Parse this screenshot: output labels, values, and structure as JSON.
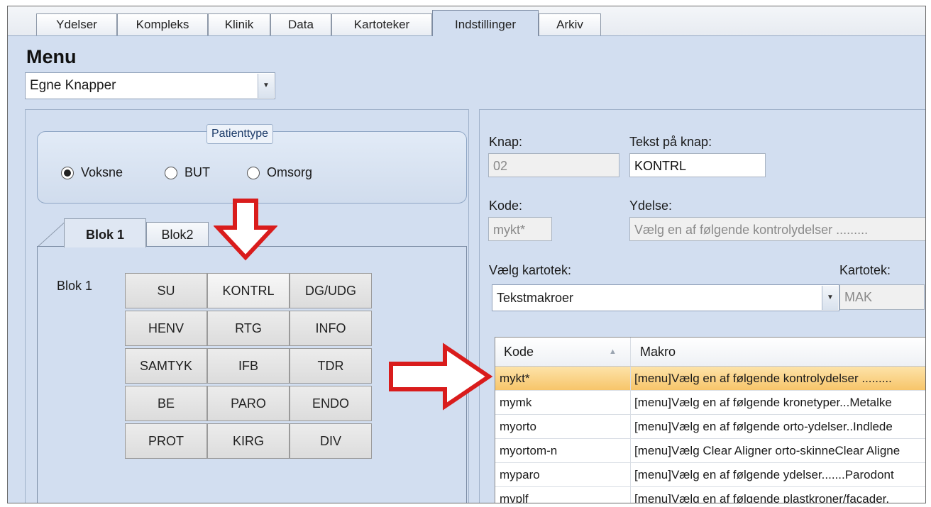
{
  "tabs": [
    "Ydelser",
    "Kompleks",
    "Klinik",
    "Data",
    "Kartoteker",
    "Indstillinger",
    "Arkiv"
  ],
  "active_tab": "Indstillinger",
  "menu": {
    "title": "Menu",
    "selected": "Egne Knapper"
  },
  "patienttype": {
    "title": "Patienttype",
    "options": [
      "Voksne",
      "BUT",
      "Omsorg"
    ],
    "selected": "Voksne"
  },
  "blok_tabs": [
    "Blok 1",
    "Blok2"
  ],
  "blok_label": "Blok 1",
  "grid_buttons": [
    [
      "SU",
      "KONTRL",
      "DG/UDG"
    ],
    [
      "HENV",
      "RTG",
      "INFO"
    ],
    [
      "SAMTYK",
      "IFB",
      "TDR"
    ],
    [
      "BE",
      "PARO",
      "ENDO"
    ],
    [
      "PROT",
      "KIRG",
      "DIV"
    ]
  ],
  "details": {
    "knap_label": "Knap:",
    "knap_value": "02",
    "tekst_label": "Tekst på knap:",
    "tekst_value": "KONTRL",
    "kode_label": "Kode:",
    "kode_value": "mykt*",
    "ydelse_label": "Ydelse:",
    "ydelse_value": "Vælg en af følgende kontrolydelser .........",
    "kartotek_choose_label": "Vælg kartotek:",
    "kartotek_choose_value": "Tekstmakroer",
    "kartotek_label": "Kartotek:",
    "kartotek_value": "MAK"
  },
  "table": {
    "columns": [
      "Kode",
      "Makro"
    ],
    "rows": [
      {
        "kode": "mykt*",
        "makro": "[menu]Vælg en af følgende kontrolydelser .........",
        "selected": true
      },
      {
        "kode": "mymk",
        "makro": "[menu]Vælg en af følgende kronetyper...Metalke"
      },
      {
        "kode": "myorto",
        "makro": "[menu]Vælg en af følgende orto-ydelser..Indlede"
      },
      {
        "kode": "myortom-n",
        "makro": "[menu]Vælg Clear Aligner orto-skinneClear Aligne"
      },
      {
        "kode": "myparo",
        "makro": "[menu]Vælg en af følgende ydelser.......Parodont"
      },
      {
        "kode": "myplf",
        "makro": "[menu]Vælg en af følgende plastkroner/facader."
      }
    ]
  },
  "colors": {
    "accent": "#d2def0",
    "selected_row": "#f7c56a",
    "arrow": "#d91c1c"
  }
}
